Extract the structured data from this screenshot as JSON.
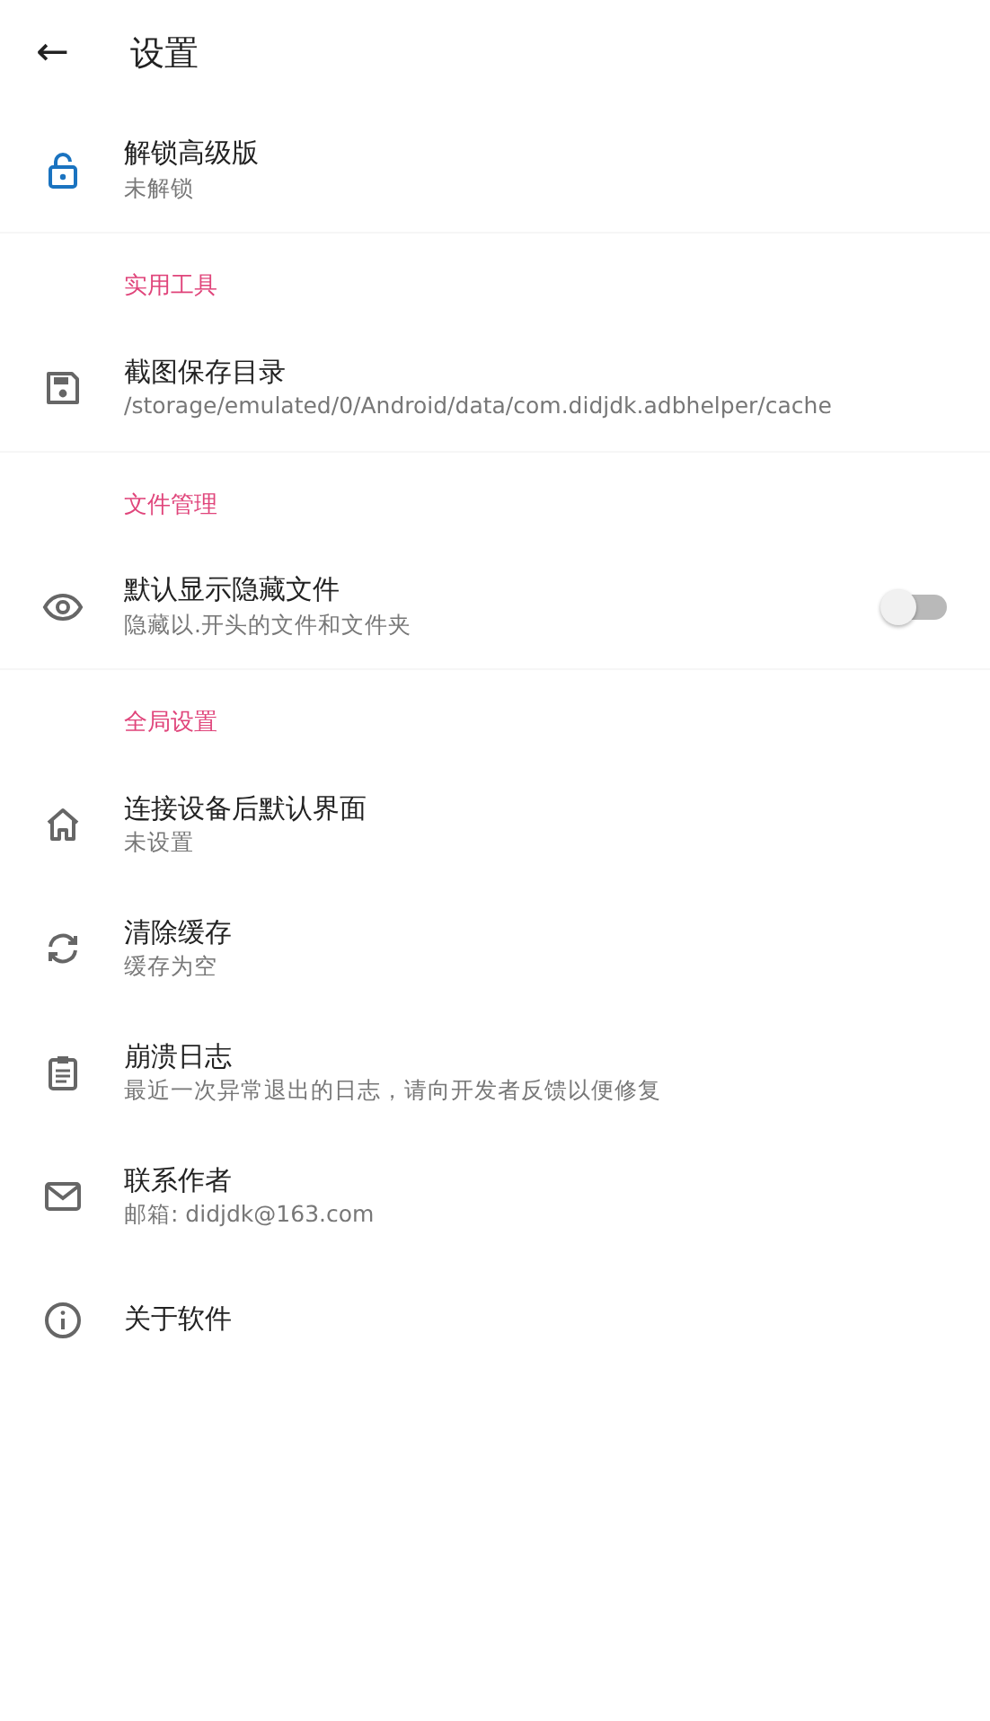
{
  "app_bar": {
    "back": "←",
    "title": "设置"
  },
  "sections": [
    {
      "items": [
        {
          "kind": "plain",
          "title": "解锁高级版",
          "subtitle": "未解锁"
        }
      ]
    },
    {
      "header": "实用工具",
      "items": [
        {
          "kind": "plain",
          "title": "截图保存目录",
          "subtitle": "/storage/emulated/0/Android/data/com.didjdk.adbhelper/cache"
        }
      ]
    },
    {
      "header": "文件管理",
      "items": [
        {
          "kind": "switch",
          "title": "默认显示隐藏文件",
          "subtitle": "隐藏以.开头的文件和文件夹",
          "on": false
        }
      ]
    },
    {
      "header": "全局设置",
      "items": [
        {
          "kind": "plain",
          "title": "连接设备后默认界面",
          "subtitle": "未设置"
        },
        {
          "kind": "plain",
          "title": "清除缓存",
          "subtitle": "缓存为空"
        },
        {
          "kind": "plain",
          "title": "崩溃日志",
          "subtitle": "最近一次异常退出的日志，请向开发者反馈以便修复"
        },
        {
          "kind": "plain",
          "title": "联系作者",
          "subtitle": "邮箱: didjdk@163.com"
        },
        {
          "kind": "plain",
          "title": "关于软件"
        }
      ]
    }
  ]
}
